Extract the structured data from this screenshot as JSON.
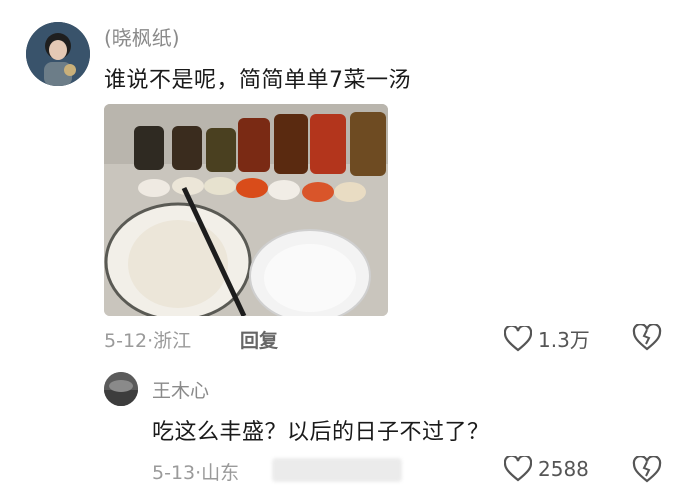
{
  "main_comment": {
    "username": "(晓枫纸)",
    "text": "谁说不是呢，简简单单7菜一汤",
    "date": "5-12",
    "location": "浙江",
    "reply_label": "回复",
    "like_count": "1.3万"
  },
  "reply_comment": {
    "username": "王木心",
    "text": "吃这么丰盛？以后的日子不过了？",
    "date": "5-13",
    "location": "山东",
    "like_count": "2588"
  },
  "icons": {
    "like": "heart-outline-icon",
    "dislike": "broken-heart-icon"
  },
  "colors": {
    "secondary_text": "#9a9a9a",
    "primary_text": "#1a1a1a"
  }
}
